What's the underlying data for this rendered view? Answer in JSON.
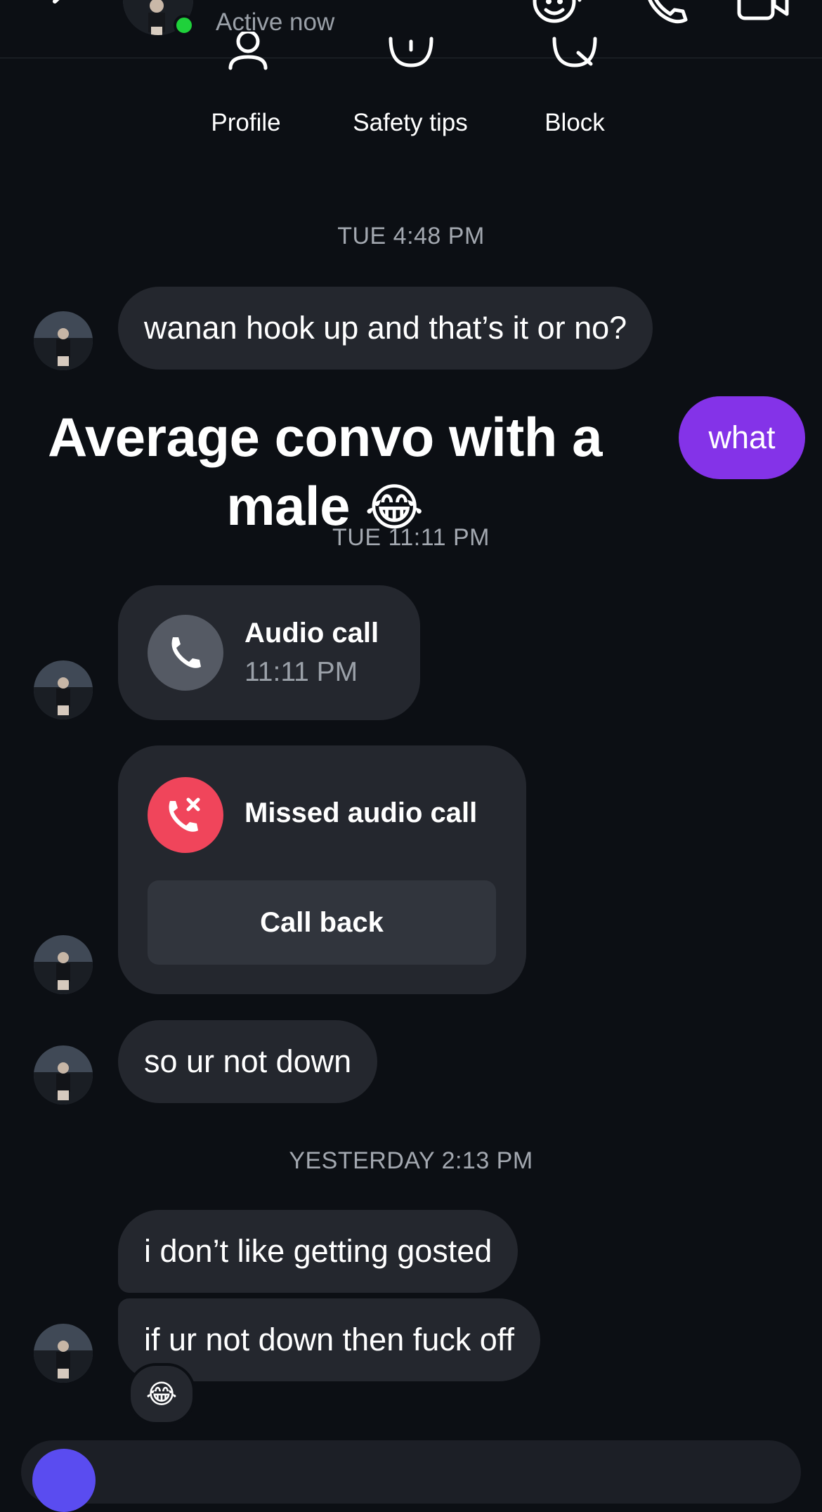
{
  "header": {
    "status": "Active now",
    "icons": [
      "back-chevron-icon",
      "sticker-icon",
      "phone-icon",
      "video-camera-icon"
    ]
  },
  "profile_actions": [
    {
      "label": "Profile",
      "icon": "person-icon"
    },
    {
      "label": "Safety tips",
      "icon": "safety-icon"
    },
    {
      "label": "Block",
      "icon": "block-icon"
    }
  ],
  "conversation": {
    "timestamps": {
      "t1": "TUE 4:48 PM",
      "t2": "TUE 11:11 PM",
      "t3": "YESTERDAY 2:13 PM"
    },
    "messages": {
      "m1": "wanan hook up and that’s it or no?",
      "m2": "what",
      "m3": "so ur not down",
      "m4": "i don’t like getting gosted",
      "m5": "if ur not down then fuck off"
    },
    "audio_call": {
      "title": "Audio call",
      "time": "11:11 PM"
    },
    "missed_call": {
      "title": "Missed audio call",
      "button": "Call back"
    },
    "reaction": "😂"
  },
  "caption": {
    "line1": "Average convo with a",
    "line2": "male",
    "emoji": "😂"
  },
  "colors": {
    "background": "#0c0f14",
    "incoming_bubble": "#24272e",
    "outgoing_bubble": "#8433e8",
    "missed_call_red": "#f0455b",
    "online_green": "#1fd13b"
  }
}
